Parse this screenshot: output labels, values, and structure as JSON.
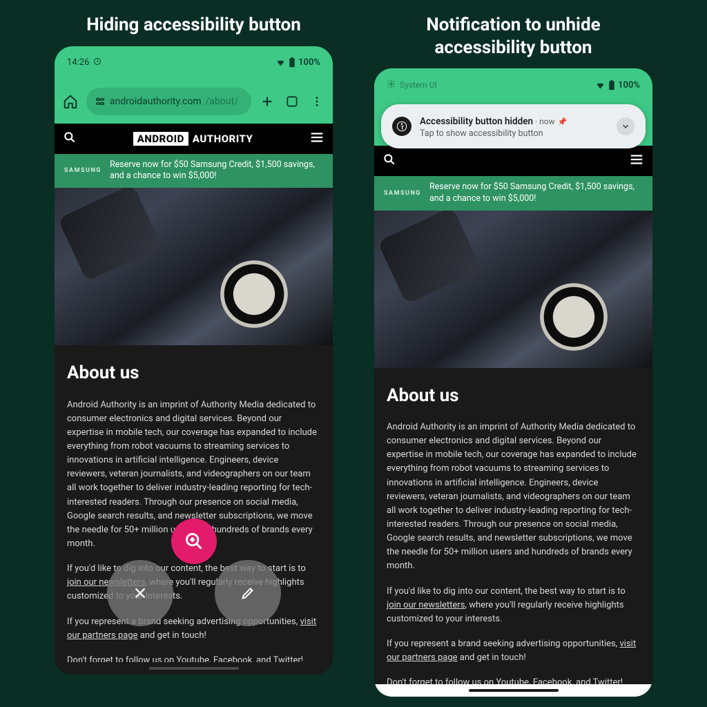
{
  "captions": {
    "left": "Hiding accessibility button",
    "right": "Notification to unhide accessibility button"
  },
  "statusbar": {
    "time": "14:26",
    "battery": "100%",
    "system_ui": "System UI"
  },
  "urlbar": {
    "domain": "androidauthority.com",
    "path": "/about/"
  },
  "site_header": {
    "logo_1": "ANDROID",
    "logo_2": "AUTHORITY"
  },
  "promo": {
    "tag": "SAMSUNG",
    "text": "Reserve now for $50 Samsung Credit, $1,500 savings, and a chance to win $5,000!"
  },
  "article": {
    "heading": "About us",
    "p1": "Android Authority is an imprint of Authority Media dedicated to consumer electronics and digital services. Beyond our expertise in mobile tech, our coverage has expanded to include everything from robot vacuums to streaming services to innovations in artificial intelligence. Engineers, device reviewers, veteran journalists, and videographers on our team all work together to deliver industry-leading reporting for tech-interested readers. Through our presence on social media, Google search results, and newsletter subscriptions, we move the needle for 50+ million users and hundreds of brands every month.",
    "p2_pre": "If you'd like to dig into our content, the best way to start is to ",
    "p2_link": "join our newsletters",
    "p2_post": ", where you'll regularly receive highlights customized to your interests.",
    "p3_pre": "If you represent a brand seeking advertising opportunities, ",
    "p3_link": "visit our partners page",
    "p3_post": " and get in touch!",
    "p4_pre": "Don't forget to follow us on ",
    "p4_l1": "Youtube",
    "p4_s1": ", ",
    "p4_l2": "Facebook",
    "p4_s2": ", and ",
    "p4_l3": "Twitter",
    "p4_end": "!"
  },
  "notification": {
    "title": "Accessibility button hidden",
    "meta": " · now",
    "subtitle": "Tap to show accessibility button"
  }
}
